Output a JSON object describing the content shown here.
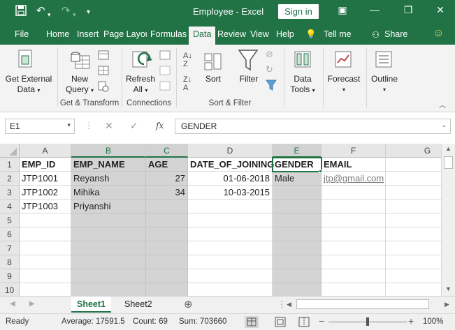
{
  "titlebar": {
    "title": "Employee  -  Excel",
    "signin": "Sign in",
    "save_icon": "save-icon",
    "undo_icon": "undo-icon",
    "redo_icon": "redo-icon"
  },
  "tabs": [
    "File",
    "Home",
    "Insert",
    "Page Layou",
    "Formulas",
    "Data",
    "Review",
    "View",
    "Help",
    "Tell me",
    "Share"
  ],
  "ribbon": {
    "get_external": [
      "Get External",
      "Data"
    ],
    "new_query": [
      "New",
      "Query"
    ],
    "group_get_transform": "Get & Transform",
    "refresh": [
      "Refresh",
      "All"
    ],
    "group_connections": "Connections",
    "sort": "Sort",
    "filter": "Filter",
    "group_sort_filter": "Sort & Filter",
    "data_tools": [
      "Data",
      "Tools"
    ],
    "forecast": "Forecast",
    "outline": "Outline"
  },
  "formula_bar": {
    "name_box": "E1",
    "fx": "fx",
    "content": "GENDER"
  },
  "columns": [
    "A",
    "B",
    "C",
    "D",
    "E",
    "F",
    "G"
  ],
  "rows": [
    "1",
    "2",
    "3",
    "4",
    "5",
    "6",
    "7",
    "8",
    "9",
    "10"
  ],
  "cells": {
    "A1": "EMP_ID",
    "B1": "EMP_NAME",
    "C1": "AGE",
    "D1": "DATE_OF_JOINING",
    "E1": "GENDER",
    "F1": "EMAIL",
    "A2": "JTP1001",
    "B2": "Reyansh",
    "C2": "27",
    "D2": "01-06-2018",
    "E2": "Male",
    "F2": "jtp@gmail.com",
    "A3": "JTP1002",
    "B3": "Mihika",
    "C3": "34",
    "D3": "10-03-2015",
    "A4": "JTP1003",
    "B4": "Priyanshi"
  },
  "sheets": [
    "Sheet1",
    "Sheet2"
  ],
  "status": {
    "ready": "Ready",
    "average": "Average: 17591.5",
    "count": "Count: 69",
    "sum": "Sum: 703660",
    "zoom": "100%"
  },
  "colors": {
    "excel_green": "#217346",
    "selected_gray": "#d4d4d4"
  }
}
